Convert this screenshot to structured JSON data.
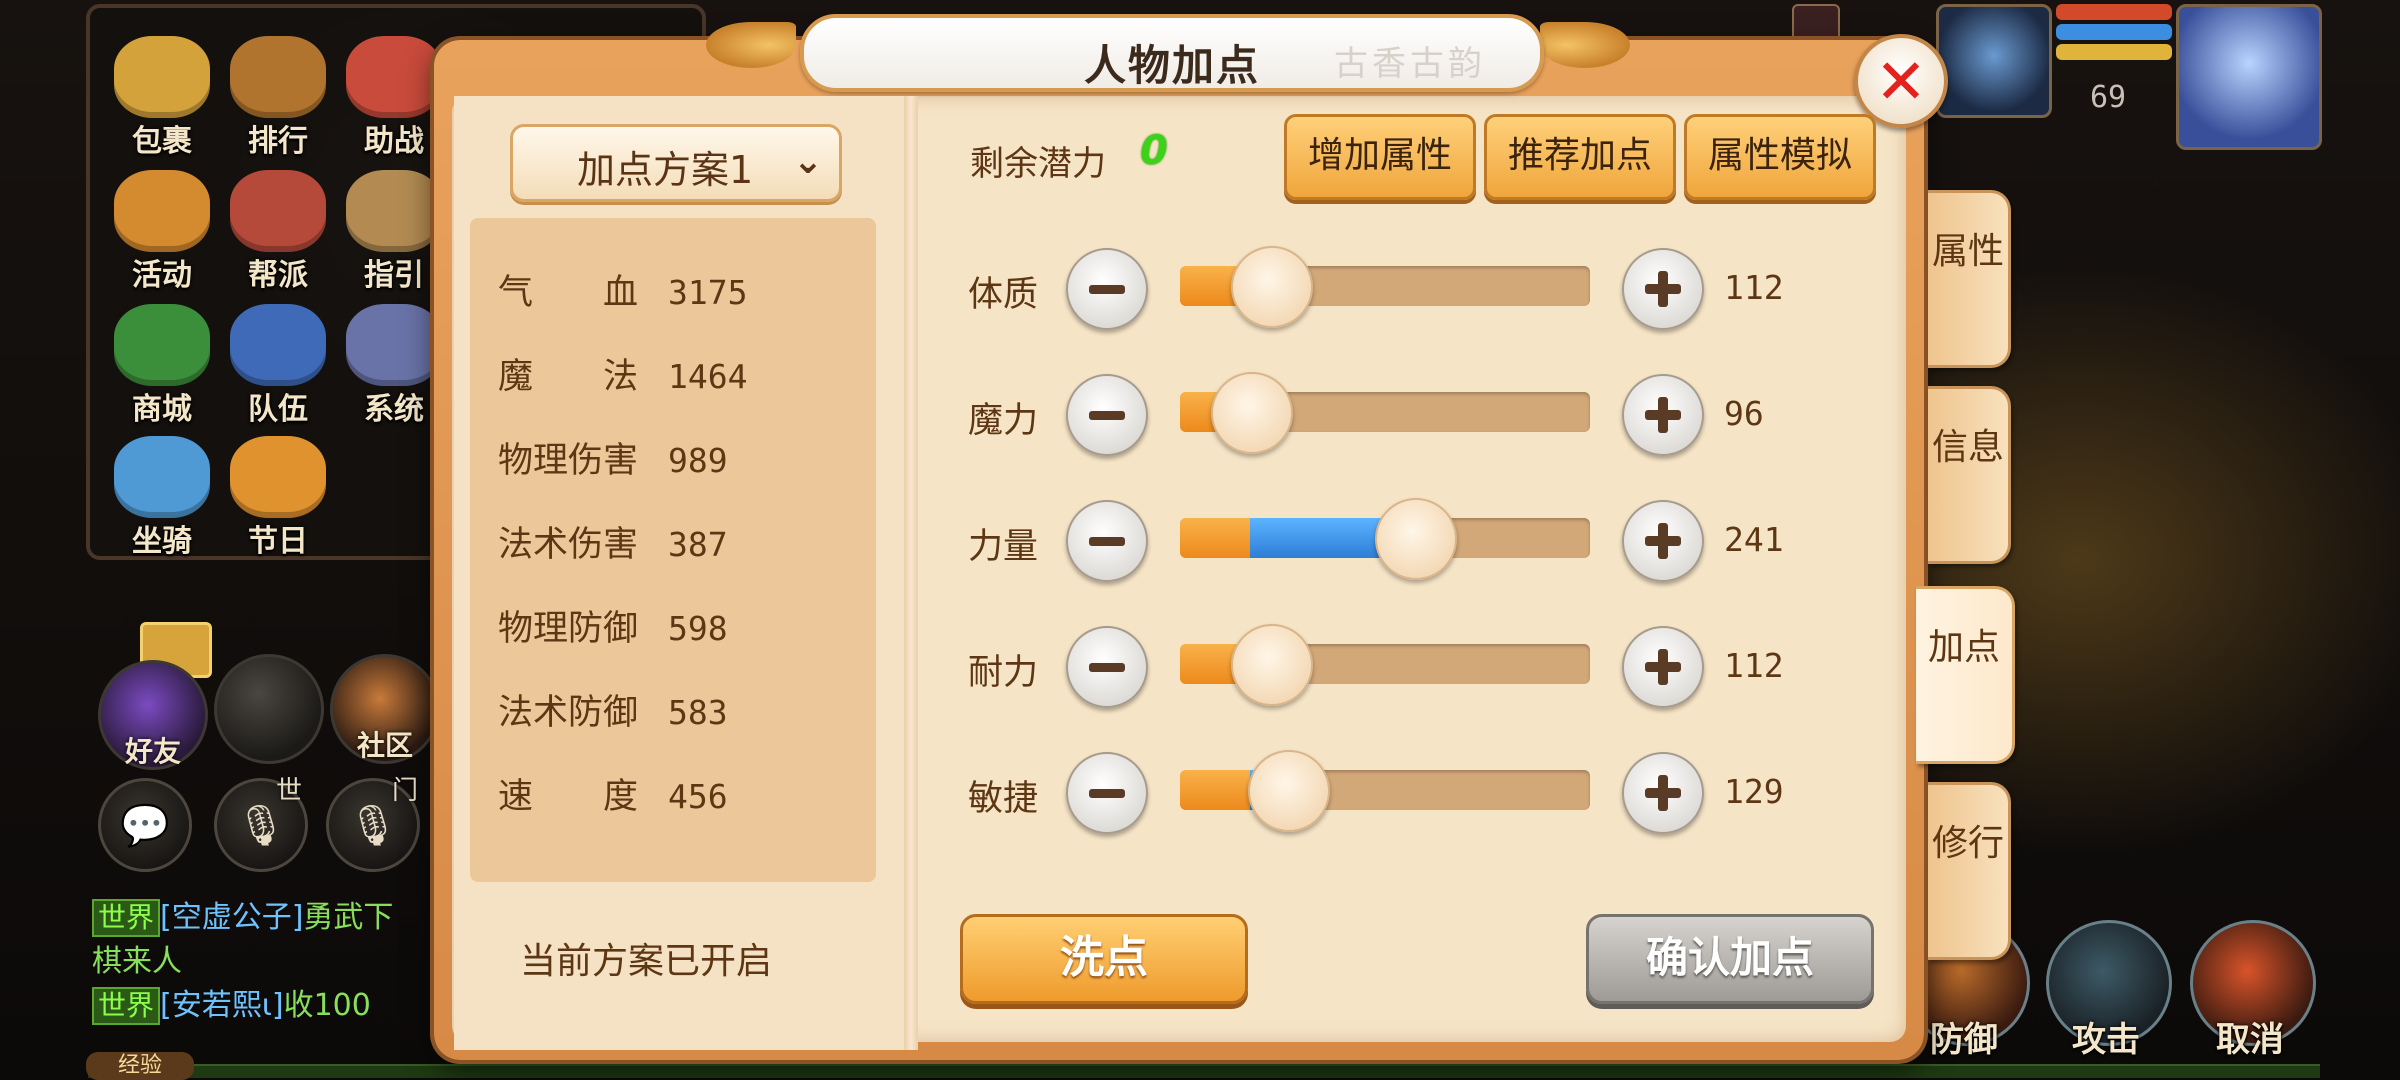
{
  "hud": {
    "menu": [
      {
        "label": "包裹",
        "color": "#d4a23a"
      },
      {
        "label": "排行",
        "color": "#b0742e"
      },
      {
        "label": "助战",
        "color": "#c94b3b"
      },
      {
        "label": "活动",
        "color": "#d48a2e"
      },
      {
        "label": "帮派",
        "color": "#b54a3a"
      },
      {
        "label": "指引",
        "color": "#b28a52"
      },
      {
        "label": "商城",
        "color": "#3c8f3a"
      },
      {
        "label": "队伍",
        "color": "#3f6ab8"
      },
      {
        "label": "系统",
        "color": "#6a73a8"
      },
      {
        "label": "坐骑",
        "color": "#4f9ad4"
      },
      {
        "label": "节日",
        "color": "#e0922e"
      }
    ],
    "social": {
      "friends_label": "好友",
      "community_label": "社区",
      "world_label": "世",
      "sect_label": "门"
    },
    "chat": [
      {
        "tag": "世界",
        "name": "[空虚公子]",
        "text": "勇武下"
      },
      {
        "tag": "",
        "name": "",
        "text": "棋来人"
      },
      {
        "tag": "世界",
        "name": "[安若熙ι]",
        "text": "收100"
      }
    ],
    "exp_label": "经验",
    "level": "69",
    "battle": {
      "defend_label": "防御",
      "attack_label": "攻击",
      "cancel_label": "取消"
    }
  },
  "dialog": {
    "title": "人物加点",
    "title_deco": "古香古韵",
    "close_label": "✕",
    "scheme": {
      "label": "加点方案1",
      "chevron": "⌄"
    },
    "stats": [
      {
        "name": "气　　血",
        "value": "3175"
      },
      {
        "name": "魔　　法",
        "value": "1464"
      },
      {
        "name": "物理伤害",
        "value": "989"
      },
      {
        "name": "法术伤害",
        "value": "387"
      },
      {
        "name": "物理防御",
        "value": "598"
      },
      {
        "name": "法术防御",
        "value": "583"
      },
      {
        "name": "速　　度",
        "value": "456"
      }
    ],
    "scheme_status": "当前方案已开启",
    "potential_label": "剩余潜力",
    "potential_value": "0",
    "buttons": {
      "add_attr": "增加属性",
      "recommend": "推荐加点",
      "simulate": "属性模拟",
      "reset": "洗点",
      "confirm": "确认加点"
    },
    "attributes": [
      {
        "name": "体质",
        "value": "112",
        "base_fraction": 0.17,
        "added_fraction": 0.02,
        "knob_fraction": 0.22
      },
      {
        "name": "魔力",
        "value": "96",
        "base_fraction": 0.17,
        "added_fraction": 0.0,
        "knob_fraction": 0.17
      },
      {
        "name": "力量",
        "value": "241",
        "base_fraction": 0.17,
        "added_fraction": 0.33,
        "knob_fraction": 0.57
      },
      {
        "name": "耐力",
        "value": "112",
        "base_fraction": 0.17,
        "added_fraction": 0.02,
        "knob_fraction": 0.22
      },
      {
        "name": "敏捷",
        "value": "129",
        "base_fraction": 0.17,
        "added_fraction": 0.05,
        "knob_fraction": 0.26
      }
    ],
    "side_tabs": [
      "属性",
      "信息",
      "加点",
      "修行"
    ],
    "active_tab": "加点"
  },
  "colors": {
    "accent_orange": "#f0a63c",
    "added_points_blue": "#2d7ed6",
    "potential_green": "#3cd21a",
    "close_red": "#e4211d"
  }
}
